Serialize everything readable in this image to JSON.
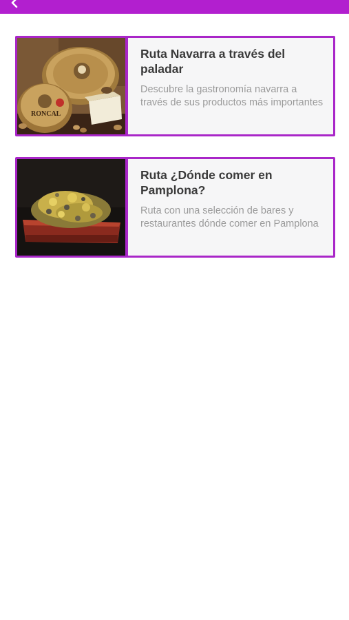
{
  "app_bar": {
    "color": "#b21fcf",
    "back_icon": "chevron-left-icon"
  },
  "routes": [
    {
      "title": "Ruta Navarra a través del paladar",
      "description": "Descubre la gastronomía navarra a través de sus productos más importantes",
      "image": "roncal-cheese-photo",
      "image_logo_text": "RONCAL"
    },
    {
      "title": "Ruta ¿Dónde comer en Pamplona?",
      "description": "Ruta con una selección de bares y restaurantes dónde comer en Pamplona",
      "image": "pintxo-photo"
    }
  ],
  "accent_color": "#a926c8"
}
